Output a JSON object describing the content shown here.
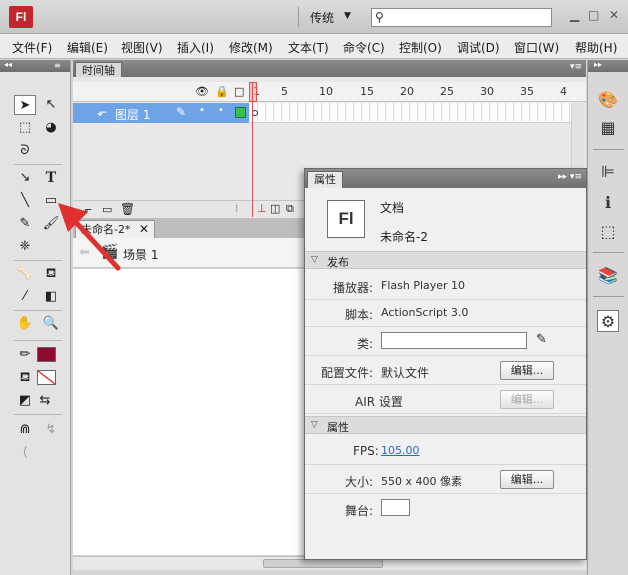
{
  "titlebar": {
    "logo": "Fl",
    "workspace": "传统",
    "search_placeholder": "",
    "minimize": "□",
    "restore": "□",
    "close": "✕"
  },
  "menu": [
    "文件(F)",
    "编辑(E)",
    "视图(V)",
    "插入(I)",
    "修改(M)",
    "文本(T)",
    "命令(C)",
    "控制(O)",
    "调试(D)",
    "窗口(W)",
    "帮助(H)"
  ],
  "timeline": {
    "tab": "时间轴",
    "frame_numbers": [
      "1",
      "5",
      "10",
      "15",
      "20",
      "25",
      "30",
      "35",
      "4"
    ],
    "layer_name": "图层 1"
  },
  "document": {
    "tab": "未命名-2*",
    "scene": "场景 1"
  },
  "properties": {
    "tab": "属性",
    "doc_icon_text": "Fl",
    "doc_type": "文档",
    "doc_name": "未命名-2",
    "sections": {
      "publish": "发布",
      "properties": "属性"
    },
    "player_label": "播放器:",
    "player_value": "Flash Player 10",
    "script_label": "脚本:",
    "script_value": "ActionScript 3.0",
    "class_label": "类:",
    "profile_label": "配置文件:",
    "profile_value": "默认文件",
    "edit": "编辑...",
    "air_label": "AIR 设置",
    "fps_label": "FPS:",
    "fps_value": "105.00",
    "size_label": "大小:",
    "size_value": "550 x 400 像素",
    "stage_label": "舞台:"
  },
  "colors": {
    "stroke_color": "#8b0a2e",
    "fill_color": "#ffffff",
    "layer_highlight": "#6fa3e8",
    "arrow": "#e03030"
  }
}
